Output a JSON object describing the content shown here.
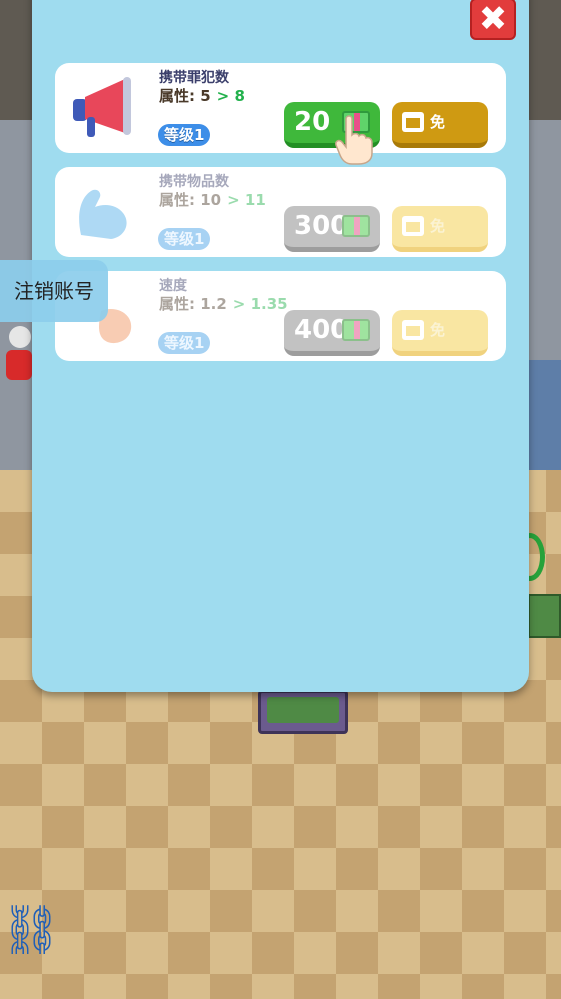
{
  "panel": {
    "close_icon": "close-icon",
    "upgrades": [
      {
        "title": "携带罪犯数",
        "attr_label": "属性: 5",
        "attr_next": "> 8",
        "level": "等级1",
        "price": "20",
        "free_label": "免",
        "icon": "megaphone-icon",
        "enabled": true
      },
      {
        "title": "携带物品数",
        "attr_label": "属性: 10",
        "attr_next": "> 11",
        "level": "等级1",
        "price": "300",
        "free_label": "免",
        "icon": "muscle-arm-icon",
        "enabled": false
      },
      {
        "title": "速度",
        "attr_label": "属性: 1.2",
        "attr_next": "> 1.35",
        "level": "等级1",
        "price": "400",
        "free_label": "免",
        "icon": "speed-icon",
        "enabled": false
      }
    ]
  },
  "side": {
    "logout_label": "注销账号"
  },
  "colors": {
    "panel_bg": "#9fdcef",
    "buy_green": "#3fb83b",
    "free_gold": "#cf9a12",
    "close_red": "#e23c3c"
  }
}
